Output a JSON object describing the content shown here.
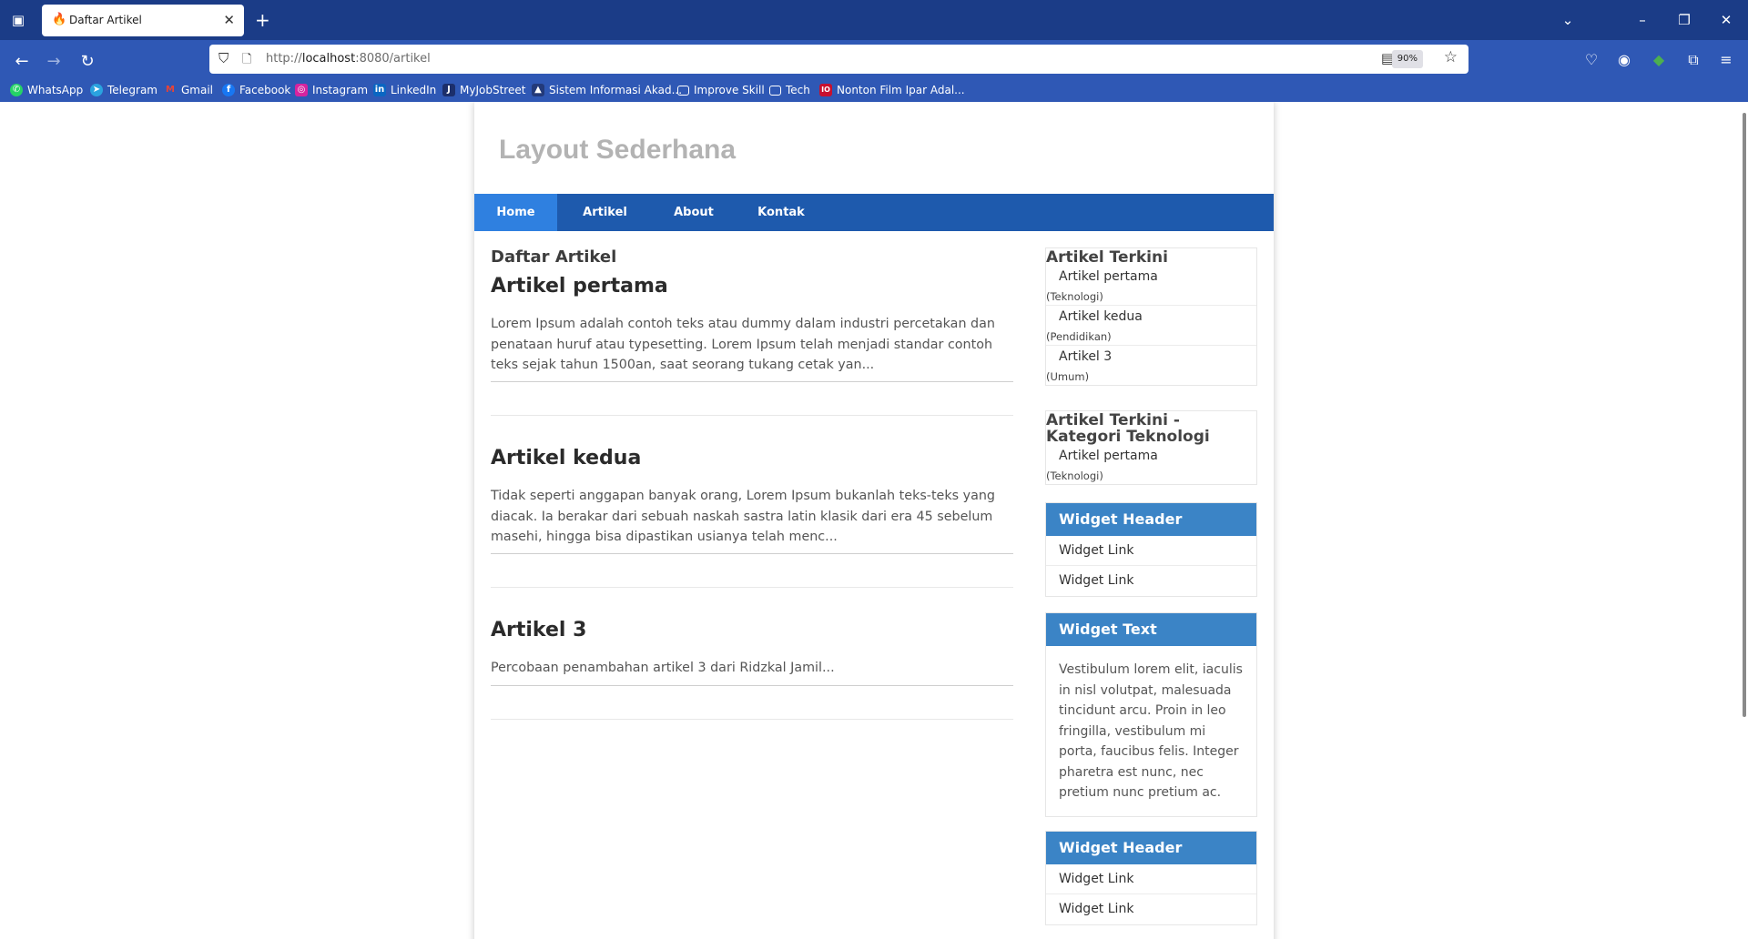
{
  "browser": {
    "tab": {
      "title": "Daftar Artikel",
      "favicon": "flame-icon"
    },
    "url": {
      "scheme": "http://",
      "host": "localhost",
      "rest": ":8080/artikel"
    },
    "zoom": "90%",
    "bookmarks": [
      {
        "label": "WhatsApp",
        "icon": "whatsapp-icon",
        "color": "#25d366"
      },
      {
        "label": "Telegram",
        "icon": "telegram-icon",
        "color": "#2aa3df"
      },
      {
        "label": "Gmail",
        "icon": "gmail-icon",
        "color": "#d93025"
      },
      {
        "label": "Facebook",
        "icon": "facebook-icon",
        "color": "#1877f2"
      },
      {
        "label": "Instagram",
        "icon": "instagram-icon",
        "color": "#d6249f"
      },
      {
        "label": "LinkedIn",
        "icon": "linkedin-icon",
        "color": "#0a66c2"
      },
      {
        "label": "MyJobStreet",
        "icon": "jobstreet-icon",
        "color": "#1c2f6b"
      },
      {
        "label": "Sistem Informasi Akad...",
        "icon": "university-icon",
        "color": "#233a7a"
      },
      {
        "label": "Improve Skill",
        "icon": "folder-icon",
        "color": "#ffffff"
      },
      {
        "label": "Tech",
        "icon": "folder-icon",
        "color": "#ffffff"
      },
      {
        "label": "Nonton Film Ipar Adal...",
        "icon": "movie-icon",
        "color": "#c8102e"
      }
    ]
  },
  "site": {
    "title": "Layout Sederhana",
    "menu": [
      {
        "label": "Home",
        "active": true
      },
      {
        "label": "Artikel",
        "active": false
      },
      {
        "label": "About",
        "active": false
      },
      {
        "label": "Kontak",
        "active": false
      }
    ]
  },
  "main": {
    "heading": "Daftar Artikel",
    "articles": [
      {
        "title": "Artikel pertama",
        "excerpt": "Lorem Ipsum adalah contoh teks atau dummy dalam industri percetakan dan penataan huruf atau typesetting. Lorem Ipsum telah menjadi standar contoh teks sejak tahun 1500an, saat seorang tukang cetak yan..."
      },
      {
        "title": "Artikel kedua",
        "excerpt": "Tidak seperti anggapan banyak orang, Lorem Ipsum bukanlah teks-teks yang diacak. Ia berakar dari sebuah naskah sastra latin klasik dari era 45 sebelum masehi, hingga bisa dipastikan usianya telah menc..."
      },
      {
        "title": "Artikel 3",
        "excerpt": "Percobaan penambahan artikel 3 dari Ridzkal Jamil..."
      }
    ]
  },
  "sidebar": {
    "recent": {
      "title": "Artikel Terkini",
      "items": [
        {
          "title": "Artikel pertama",
          "category": "(Teknologi)"
        },
        {
          "title": "Artikel kedua",
          "category": "(Pendidikan)"
        },
        {
          "title": "Artikel 3",
          "category": "(Umum)"
        }
      ]
    },
    "recent_tech": {
      "title": "Artikel Terkini - Kategori Teknologi",
      "items": [
        {
          "title": "Artikel pertama",
          "category": "(Teknologi)"
        }
      ]
    },
    "widget1": {
      "header": "Widget Header",
      "links": [
        "Widget Link",
        "Widget Link"
      ]
    },
    "widget_text": {
      "header": "Widget Text",
      "text": "Vestibulum lorem elit, iaculis in nisl volutpat, malesuada tincidunt arcu. Proin in leo fringilla, vestibulum mi porta, faucibus felis. Integer pharetra est nunc, nec pretium nunc pretium ac."
    },
    "widget2": {
      "header": "Widget Header",
      "links": [
        "Widget Link",
        "Widget Link"
      ]
    }
  }
}
